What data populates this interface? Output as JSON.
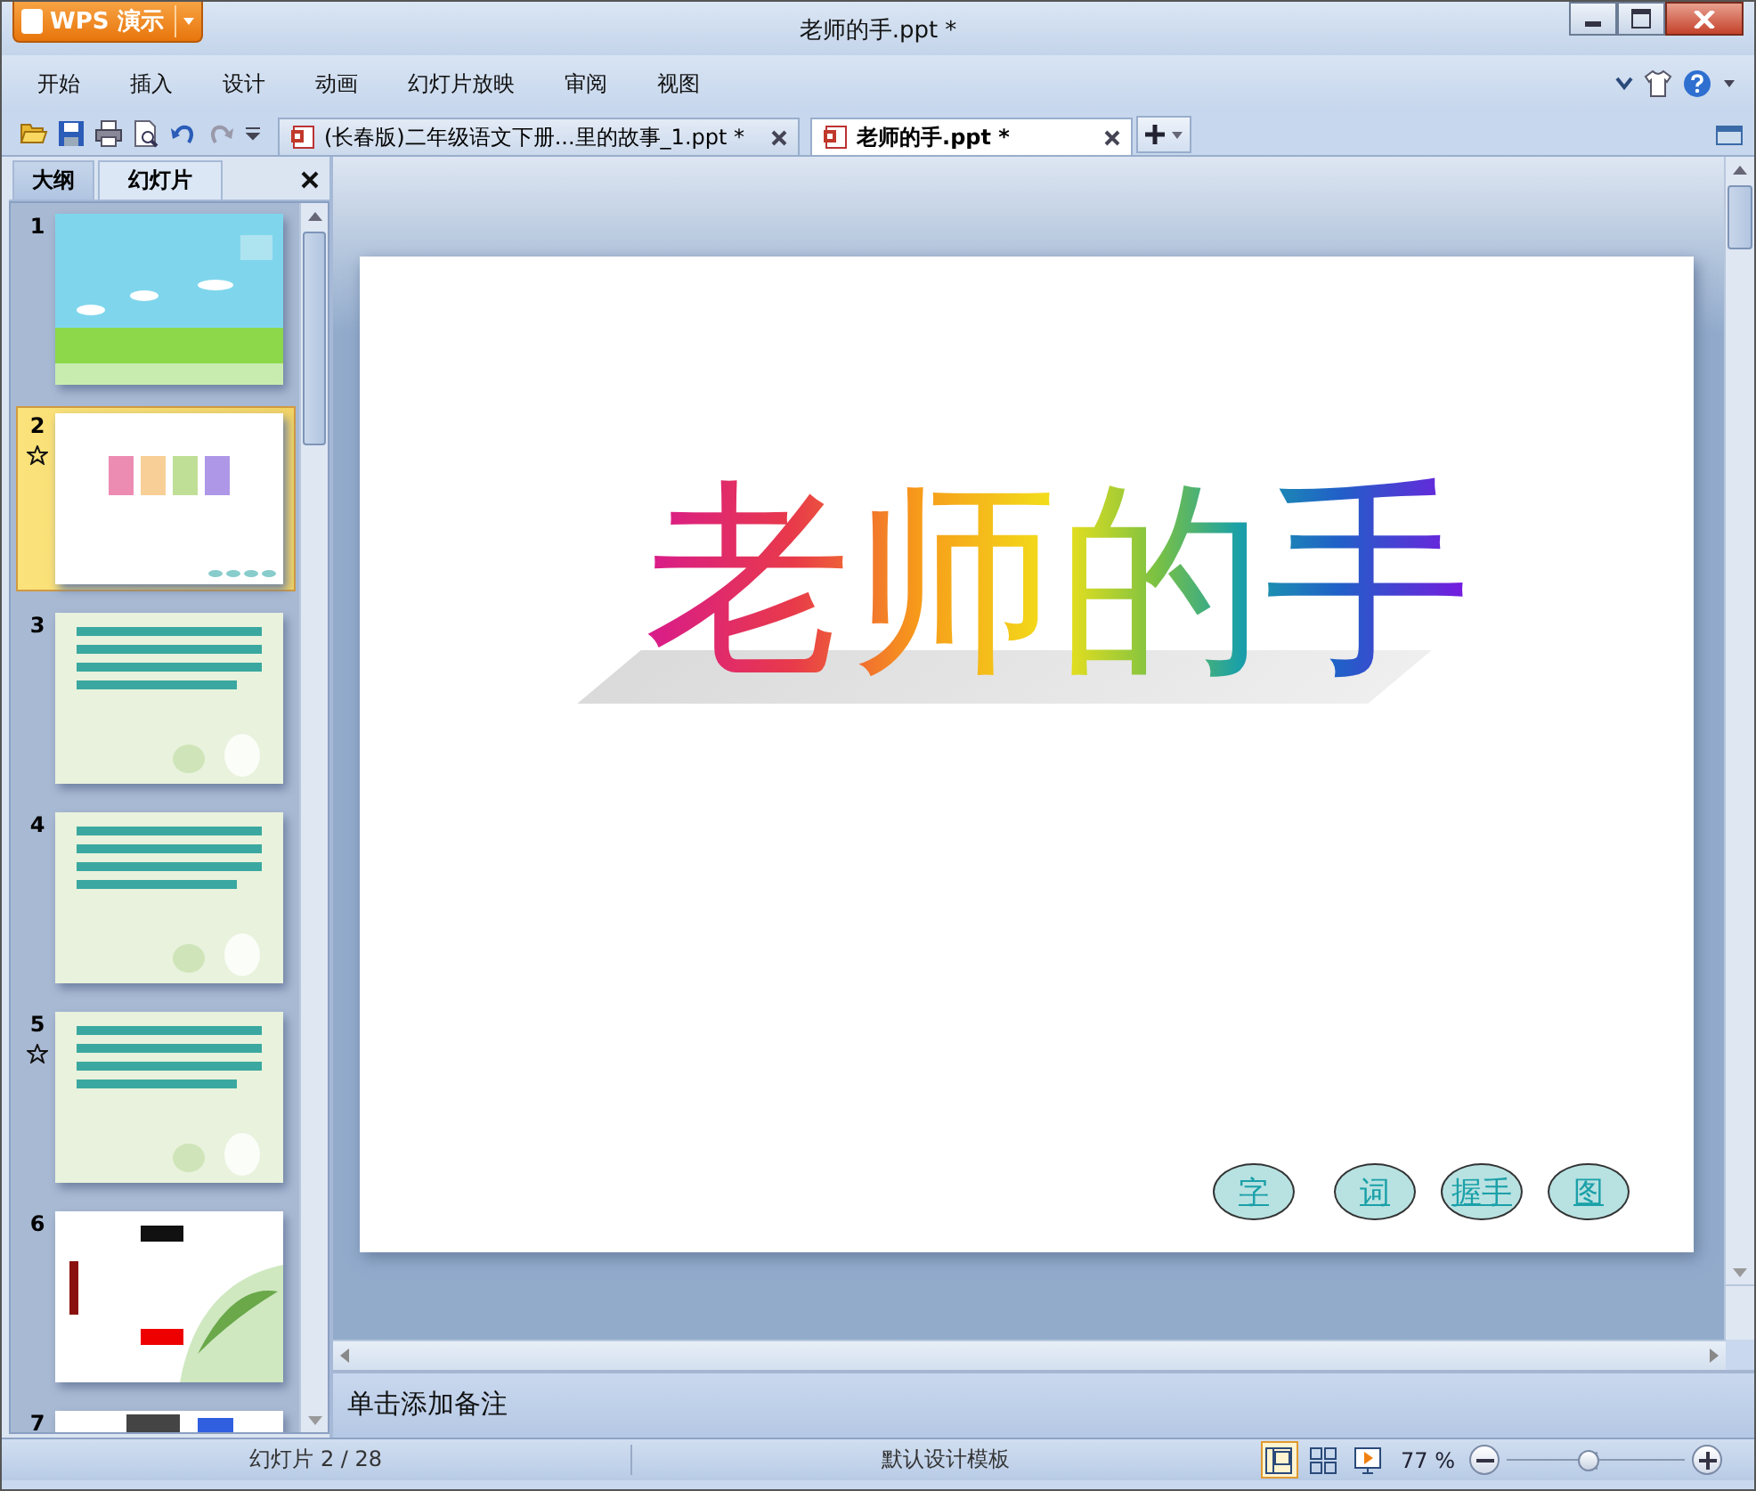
{
  "app_button": {
    "label": "WPS 演示"
  },
  "window": {
    "title": "老师的手.ppt *"
  },
  "menu": [
    "开始",
    "插入",
    "设计",
    "动画",
    "幻灯片放映",
    "审阅",
    "视图"
  ],
  "doc_tabs": [
    {
      "label": "(长春版)二年级语文下册...里的故事_1.ppt *",
      "selected": false
    },
    {
      "label": "老师的手.ppt *",
      "selected": true
    }
  ],
  "panel": {
    "tabs": [
      {
        "label": "大纲",
        "selected": false
      },
      {
        "label": "幻灯片",
        "selected": true
      }
    ]
  },
  "slides": [
    {
      "number": "1",
      "selected": false,
      "animated": false
    },
    {
      "number": "2",
      "selected": true,
      "animated": true
    },
    {
      "number": "3",
      "selected": false,
      "animated": false
    },
    {
      "number": "4",
      "selected": false,
      "animated": false
    },
    {
      "number": "5",
      "selected": false,
      "animated": true
    },
    {
      "number": "6",
      "selected": false,
      "animated": false
    },
    {
      "number": "7",
      "selected": false,
      "animated": false
    }
  ],
  "slide": {
    "title": "老师的手",
    "buttons": [
      "字",
      "词",
      "握手",
      "图"
    ]
  },
  "notes": {
    "placeholder": "单击添加备注"
  },
  "status_bar": {
    "slide_counter": "幻灯片 2 / 28",
    "template": "默认设计模板",
    "views": [
      {
        "selected": true
      },
      {
        "selected": false
      },
      {
        "selected": false
      }
    ],
    "zoom": "77 %",
    "zoom_slider": {
      "level": 0.46
    }
  }
}
